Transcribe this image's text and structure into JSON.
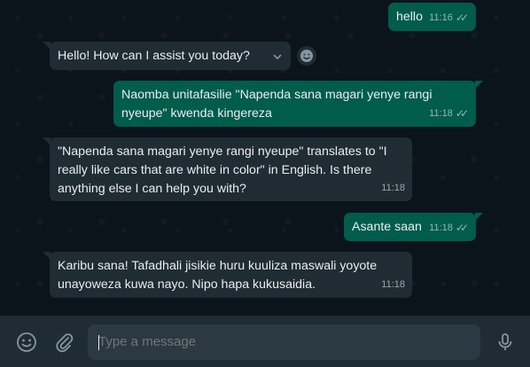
{
  "messages": [
    {
      "text": "hello",
      "time": "11:16"
    },
    {
      "text": "Hello! How can I assist you today?"
    },
    {
      "text": "Naomba unitafasilie \"Napenda sana magari yenye rangi nyeupe\" kwenda kingereza",
      "time": "11:18"
    },
    {
      "text": "\"Napenda sana magari yenye rangi nyeupe\" translates to \"I really like cars that are white in color\" in English. Is there anything else I can help you with?",
      "time": "11:18"
    },
    {
      "text": "Asante saan",
      "time": "11:18"
    },
    {
      "text": "Karibu sana! Tafadhali jisikie huru kuuliza maswali yoyote unayoweza kuwa nayo. Nipo hapa kukusaidia.",
      "time": "11:18"
    }
  ],
  "composer": {
    "placeholder": "Type a message"
  },
  "icons": {
    "emoji": "smiley-icon",
    "attach": "paperclip-icon",
    "mic": "microphone-icon",
    "reaction": "smiley-reaction-icon",
    "menu": "chevron-down-icon",
    "read_receipt": "double-check-icon"
  },
  "colors": {
    "background": "#0b141a",
    "outgoing_bubble": "#005c4b",
    "incoming_bubble": "#202c33",
    "composer_bar": "#202c33",
    "input": "#2a3942"
  }
}
